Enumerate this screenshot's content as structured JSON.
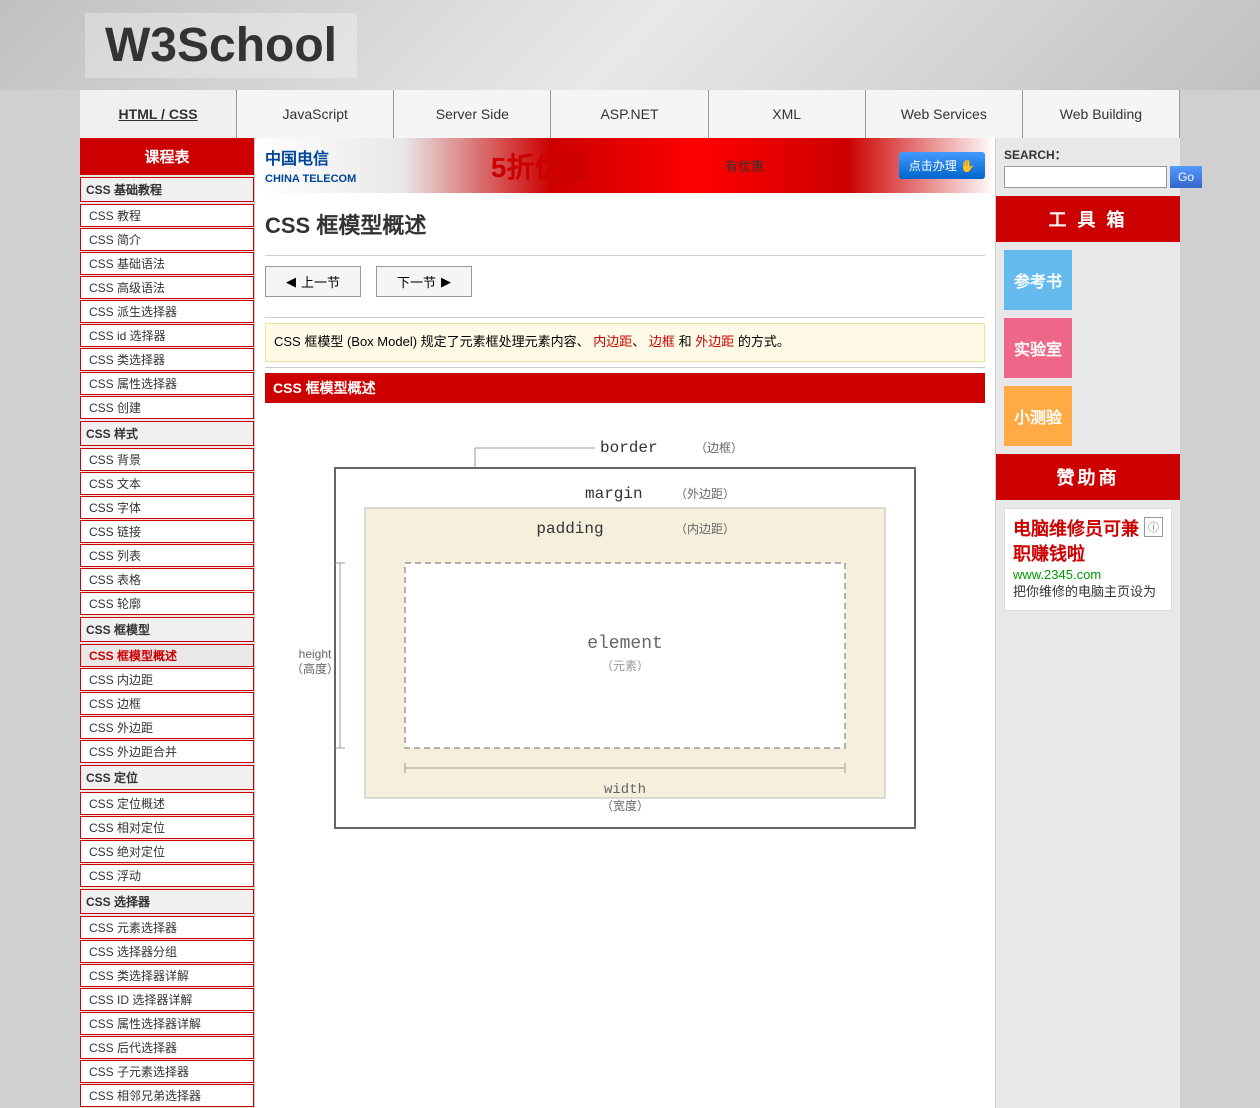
{
  "header": {
    "logo": "W3School"
  },
  "nav": {
    "items": [
      {
        "label": "HTML / CSS",
        "active": true
      },
      {
        "label": "JavaScript",
        "active": false
      },
      {
        "label": "Server Side",
        "active": false
      },
      {
        "label": "ASP.NET",
        "active": false
      },
      {
        "label": "XML",
        "active": false
      },
      {
        "label": "Web Services",
        "active": false
      },
      {
        "label": "Web Building",
        "active": false
      }
    ]
  },
  "sidebar": {
    "title": "课程表",
    "sections": [
      {
        "title": "CSS 基础教程",
        "items": [
          "CSS 教程",
          "CSS 简介",
          "CSS 基础语法",
          "CSS 高级语法",
          "CSS 派生选择器",
          "CSS id 选择器",
          "CSS 类选择器",
          "CSS 属性选择器",
          "CSS 创建"
        ]
      },
      {
        "title": "CSS 样式",
        "items": [
          "CSS 背景",
          "CSS 文本",
          "CSS 字体",
          "CSS 链接",
          "CSS 列表",
          "CSS 表格",
          "CSS 轮廓"
        ]
      },
      {
        "title": "CSS 框模型",
        "items": [
          "CSS 框模型概述",
          "CSS 内边距",
          "CSS 边框",
          "CSS 外边距",
          "CSS 外边距合并"
        ]
      },
      {
        "title": "CSS 定位",
        "items": [
          "CSS 定位概述",
          "CSS 相对定位",
          "CSS 绝对定位",
          "CSS 浮动"
        ]
      },
      {
        "title": "CSS 选择器",
        "items": [
          "CSS 元素选择器",
          "CSS 选择器分组",
          "CSS 类选择器详解",
          "CSS ID 选择器详解",
          "CSS 属性选择器详解",
          "CSS 后代选择器",
          "CSS 子元素选择器",
          "CSS 相邻兄弟选择器"
        ]
      }
    ]
  },
  "content": {
    "page_title": "CSS 框模型概述",
    "prev_label": "上一节",
    "next_label": "下一节",
    "highlight_text": "CSS 框模型 (Box Model) 规定了元素框处理元素内容、",
    "highlight_link1": "内边距",
    "highlight_link2": "边框",
    "highlight_link3": "外边距",
    "highlight_suffix": " 和  的方式。",
    "section_header": "CSS 框模型概述",
    "diagram": {
      "border_label": "border",
      "border_zh": "（边框）",
      "margin_label": "margin",
      "margin_zh": "（外边距）",
      "padding_label": "padding",
      "padding_zh": "（内边距）",
      "element_label": "element",
      "element_zh": "（元素）",
      "height_label": "height",
      "height_zh": "（高度）",
      "width_label": "width",
      "width_zh": "（宽度）"
    }
  },
  "right_sidebar": {
    "search": {
      "label": "SEARCH：",
      "placeholder": "",
      "button": "Go"
    },
    "toolbox": {
      "title": "工 具 箱",
      "ref_label": "参考书",
      "lab_label": "实验室",
      "test_label": "小测验"
    },
    "sponsor": {
      "title": "赞助商",
      "info_icon": "ⓘ",
      "link": "www.2345.com",
      "ad_title": "电脑维修员可兼职赚钱啦",
      "ad_text": "把你维修的电脑主页设为"
    }
  }
}
